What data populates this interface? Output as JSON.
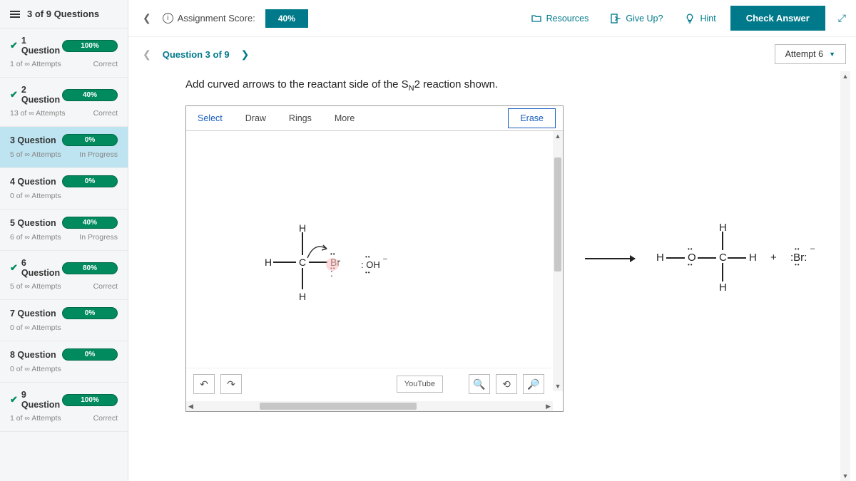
{
  "sidebar": {
    "header": "3 of 9 Questions",
    "items": [
      {
        "title": "1 Question",
        "percent": "100%",
        "attempts": "1 of ∞ Attempts",
        "status": "Correct",
        "checked": true
      },
      {
        "title": "2 Question",
        "percent": "40%",
        "attempts": "13 of ∞ Attempts",
        "status": "Correct",
        "checked": true
      },
      {
        "title": "3 Question",
        "percent": "0%",
        "attempts": "5 of ∞ Attempts",
        "status": "In Progress",
        "checked": false,
        "active": true
      },
      {
        "title": "4 Question",
        "percent": "0%",
        "attempts": "0 of ∞ Attempts",
        "status": "",
        "checked": false
      },
      {
        "title": "5 Question",
        "percent": "40%",
        "attempts": "6 of ∞ Attempts",
        "status": "In Progress",
        "checked": false
      },
      {
        "title": "6 Question",
        "percent": "80%",
        "attempts": "5 of ∞ Attempts",
        "status": "Correct",
        "checked": true
      },
      {
        "title": "7 Question",
        "percent": "0%",
        "attempts": "0 of ∞ Attempts",
        "status": "",
        "checked": false
      },
      {
        "title": "8 Question",
        "percent": "0%",
        "attempts": "0 of ∞ Attempts",
        "status": "",
        "checked": false
      },
      {
        "title": "9 Question",
        "percent": "100%",
        "attempts": "1 of ∞ Attempts",
        "status": "Correct",
        "checked": true
      }
    ]
  },
  "topbar": {
    "score_label": "Assignment Score:",
    "score_value": "40%",
    "resources": "Resources",
    "giveup": "Give Up?",
    "hint": "Hint",
    "check": "Check Answer"
  },
  "subbar": {
    "question": "Question 3 of 9",
    "attempt": "Attempt 6"
  },
  "prompt": {
    "pre": "Add curved arrows to the reactant side of the S",
    "sub": "N",
    "post": "2 reaction shown."
  },
  "editor": {
    "tabs": [
      "Select",
      "Draw",
      "Rings",
      "More"
    ],
    "erase": "Erase",
    "youtube": "YouTube"
  },
  "molecule": {
    "center": "C",
    "left": "H",
    "top": "H",
    "bottom": "H",
    "right": "Br",
    "nuc": "OH"
  },
  "product": {
    "h1": "H",
    "o": "O",
    "c": "C",
    "h2": "H",
    "h3": "H",
    "h4": "H",
    "plus": "+",
    "br": ":Br:",
    "neg": "–"
  }
}
